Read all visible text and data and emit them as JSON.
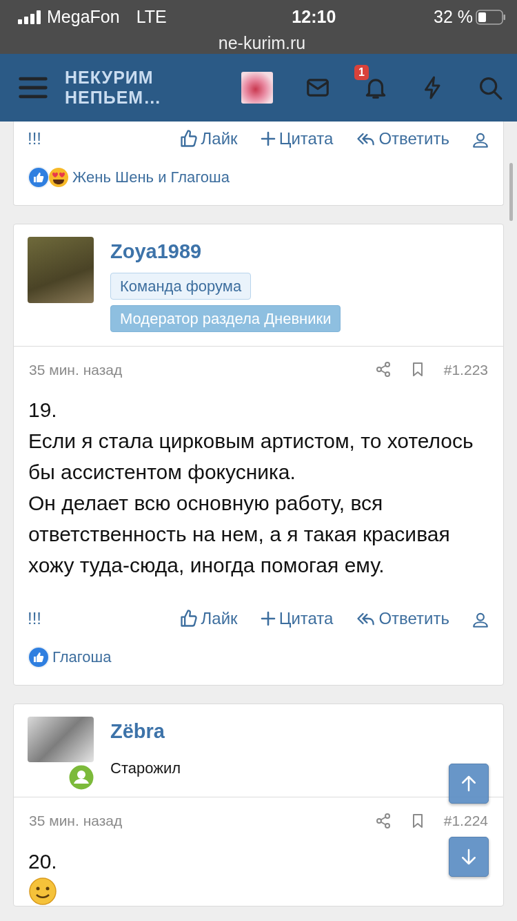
{
  "status_bar": {
    "carrier": "MegaFon",
    "network": "LTE",
    "time": "12:10",
    "battery": "32 %",
    "url": "ne-kurim.ru"
  },
  "header": {
    "logo_lines": [
      "НЕКУРИМ",
      "НЕПЬЕМ…"
    ],
    "notification_count": "1"
  },
  "posts": [
    {
      "kind": "tail",
      "actions": {
        "flag": "!!!",
        "like": "Лайк",
        "quote": "Цитата",
        "reply": "Ответить"
      },
      "reactions": {
        "kind": "double",
        "names": "Жень Шень и Глагоша"
      }
    },
    {
      "kind": "full",
      "author": "Zoya1989",
      "online": false,
      "banners": [
        {
          "text": "Команда форума",
          "kind": "light"
        },
        {
          "text": "Модератор раздела Дневники",
          "kind": "dark"
        }
      ],
      "time": "35 мин. назад",
      "number": "#1.223",
      "body": [
        "19.",
        "Если я стала цирковым артистом, то хотелось бы ассистентом фокусника.",
        "Он делает всю основную работу, вся ответственность на нем, а я такая красивая хожу туда-сюда, иногда помогая ему."
      ],
      "actions": {
        "flag": "!!!",
        "like": "Лайк",
        "quote": "Цитата",
        "reply": "Ответить"
      },
      "reactions": {
        "kind": "single",
        "names": "Глагоша"
      }
    },
    {
      "kind": "head",
      "author": "Zëbra",
      "online": true,
      "user_title": "Старожил",
      "time": "35 мин. назад",
      "number": "#1.224",
      "body": [
        "20."
      ],
      "emoji": true
    }
  ]
}
